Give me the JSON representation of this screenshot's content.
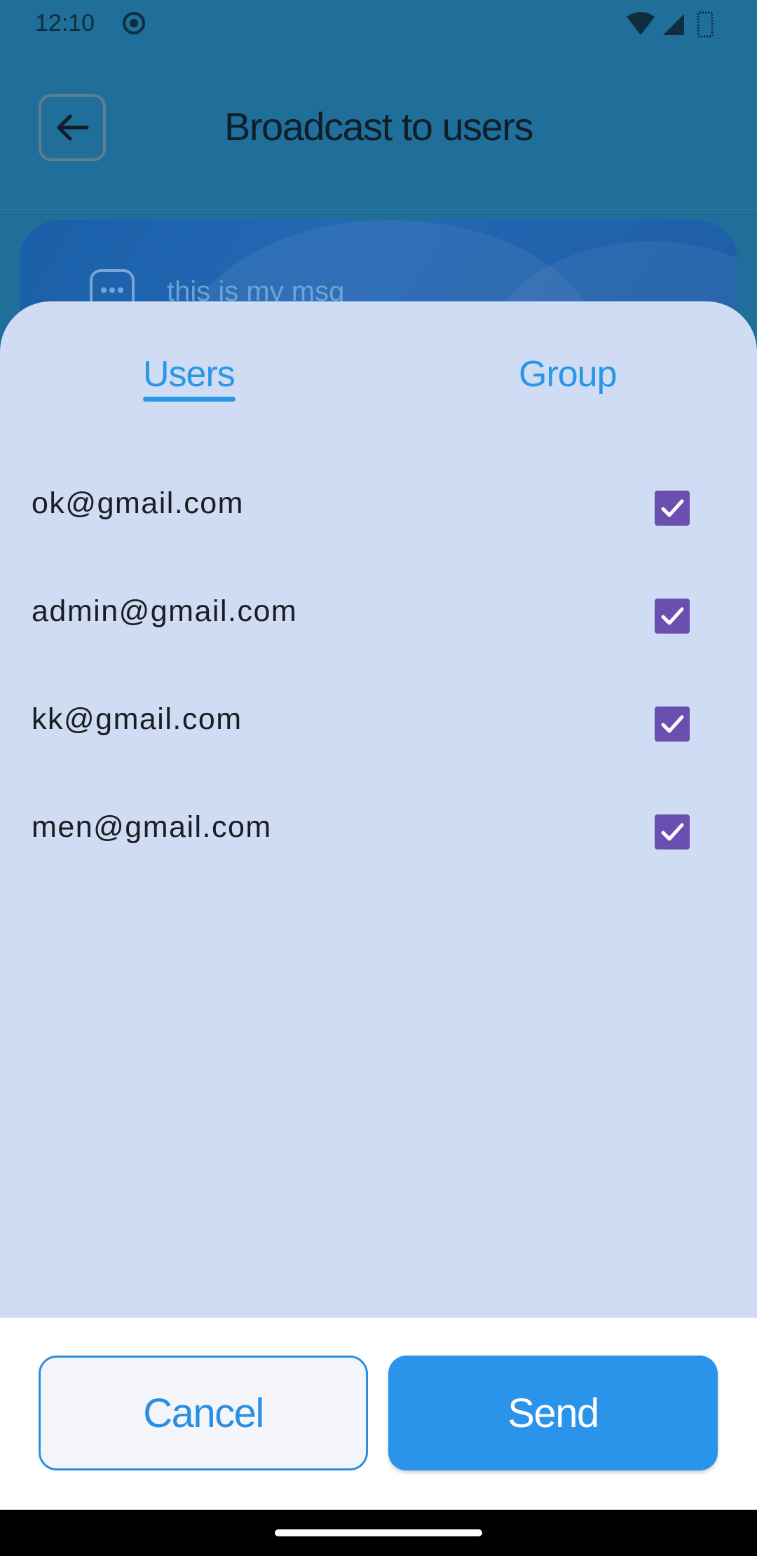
{
  "status_bar": {
    "time": "12:10"
  },
  "header": {
    "title": "Broadcast to users"
  },
  "message_preview": {
    "text": "this is my msg"
  },
  "sheet": {
    "tabs": [
      {
        "label": "Users",
        "selected": true
      },
      {
        "label": "Group",
        "selected": false
      }
    ],
    "users": [
      {
        "email": "ok@gmail.com",
        "checked": true
      },
      {
        "email": "admin@gmail.com",
        "checked": true
      },
      {
        "email": "kk@gmail.com",
        "checked": true
      },
      {
        "email": "men@gmail.com",
        "checked": true
      }
    ]
  },
  "footer": {
    "cancel_label": "Cancel",
    "send_label": "Send"
  },
  "colors": {
    "accent": "#2a93ea",
    "sheet_background": "#cfdcf3",
    "checkbox": "#6b4fb0",
    "app_background": "#1f6f9a"
  }
}
